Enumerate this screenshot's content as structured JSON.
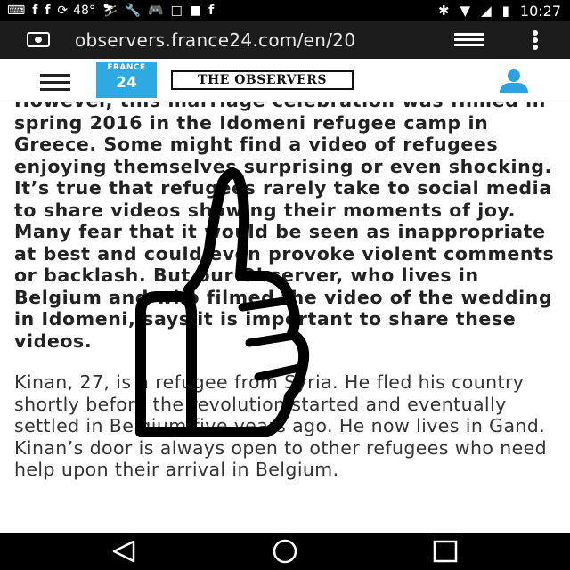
{
  "status_bar": {
    "temperature": "48°",
    "time": "10:27"
  },
  "browser": {
    "url": "observers.france24.com/en/20"
  },
  "site_header": {
    "logo_top": "FRANCE",
    "logo_bottom": "24",
    "brand": "THE OBSERVERS"
  },
  "article": {
    "bold_paragraph": "However, this marriage celebration was filmed in spring 2016 in the Idomeni refugee camp in Greece. Some might find a video of refugees enjoying themselves surprising or even shocking. It’s true that refugees rarely take to social media to share videos showing their moments of joy. Many fear that it would be seen as inappropriate at best and could even provoke violent comments or backlash. But our Observer, who lives in Belgium and who filmed the video of the wedding in Idomeni, says it is important to share these videos.",
    "regular_paragraph": "Kinan, 27, is a refugee from Syria. He fled his country shortly before the revolution started and eventually settled in Belgium five years ago. He now lives in Gand. Kinan’s door is always open to other refugees who need help upon their arrival in Belgium."
  },
  "colors": {
    "status_bar_bg": "#000000",
    "url_bar_bg": "#1c1c1c",
    "france24_blue": "#2fa9e1",
    "user_icon_blue": "#2fa0e0"
  },
  "icons": {
    "status_left": [
      "chat-icon",
      "facebook-icon",
      "facebook-icon",
      "sync-icon",
      "weather-icon",
      "ski-icon",
      "wrench-icon",
      "gamepad-icon",
      "vk-icon",
      "wolf-icon",
      "facebook-icon"
    ],
    "status_right": [
      "bluetooth-icon",
      "wifi-icon",
      "signal-icon",
      "battery-icon"
    ],
    "overlay": "thumbs-up-drawing"
  }
}
